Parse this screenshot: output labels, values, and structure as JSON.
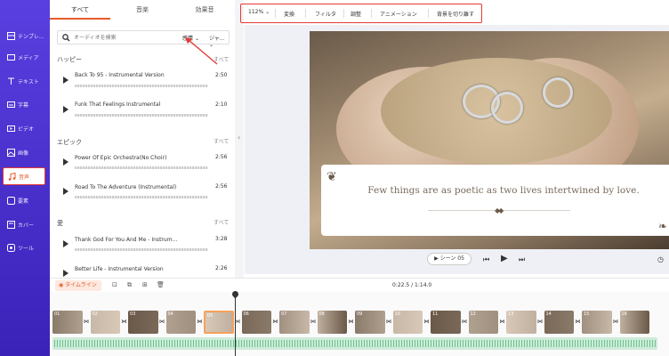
{
  "sidebar": {
    "items": [
      {
        "label": "テンプレ...",
        "icon": "template-icon"
      },
      {
        "label": "メディア",
        "icon": "media-icon"
      },
      {
        "label": "テキスト",
        "icon": "text-icon"
      },
      {
        "label": "字幕",
        "icon": "subtitle-icon"
      },
      {
        "label": "ビデオ",
        "icon": "video-icon"
      },
      {
        "label": "画像",
        "icon": "image-icon"
      },
      {
        "label": "音声",
        "icon": "music-icon"
      },
      {
        "label": "要素",
        "icon": "elements-icon"
      },
      {
        "label": "カバー",
        "icon": "cover-icon"
      },
      {
        "label": "ツール",
        "icon": "tools-icon"
      }
    ],
    "active_index": 6
  },
  "panel": {
    "tabs": [
      "すべて",
      "音楽",
      "効果音"
    ],
    "search": {
      "placeholder": "オーディオを検索",
      "filter1": "感情",
      "filter2": "ジャ..."
    },
    "categories": [
      {
        "name": "ハッピー",
        "more": "すべて",
        "tracks": [
          {
            "name": "Back To 95 - Instrumental Version",
            "duration": "2:50"
          },
          {
            "name": "Funk That Feelings Instrumental",
            "duration": "2:10"
          }
        ]
      },
      {
        "name": "エピック",
        "more": "すべて",
        "tracks": [
          {
            "name": "Power Of Epic Orchestra(No Choir)",
            "duration": "2:56"
          },
          {
            "name": "Road To The Adventure (Instrumental)",
            "duration": "2:56"
          }
        ]
      },
      {
        "name": "愛",
        "more": "すべて",
        "tracks": [
          {
            "name": "Thank God For You And Me - Instrum...",
            "duration": "3:28"
          },
          {
            "name": "Better Life - Instrumental Version",
            "duration": "2:26"
          }
        ]
      }
    ]
  },
  "toolbar": {
    "zoom": "112%",
    "items": [
      "変換",
      "フィルタ",
      "調整",
      "アニメーション",
      "背景を切り離す"
    ]
  },
  "preview": {
    "quote": "Few things are as poetic as two lives intertwined by love.",
    "scene_label": "シーン 05"
  },
  "timeline": {
    "button_label": "タイムライン",
    "timecode": "0:22.5 / 1:14.0",
    "clip_numbers": [
      "01",
      "02",
      "03",
      "04",
      "05",
      "06",
      "07",
      "08",
      "09",
      "10",
      "11",
      "12",
      "13",
      "14",
      "15",
      "16"
    ],
    "selected_clip": 4
  },
  "colors": {
    "sidebar": "#4a30cc",
    "accent": "#e85a2a",
    "highlight_border": "#e53935",
    "audio_track": "#cdebd9"
  }
}
